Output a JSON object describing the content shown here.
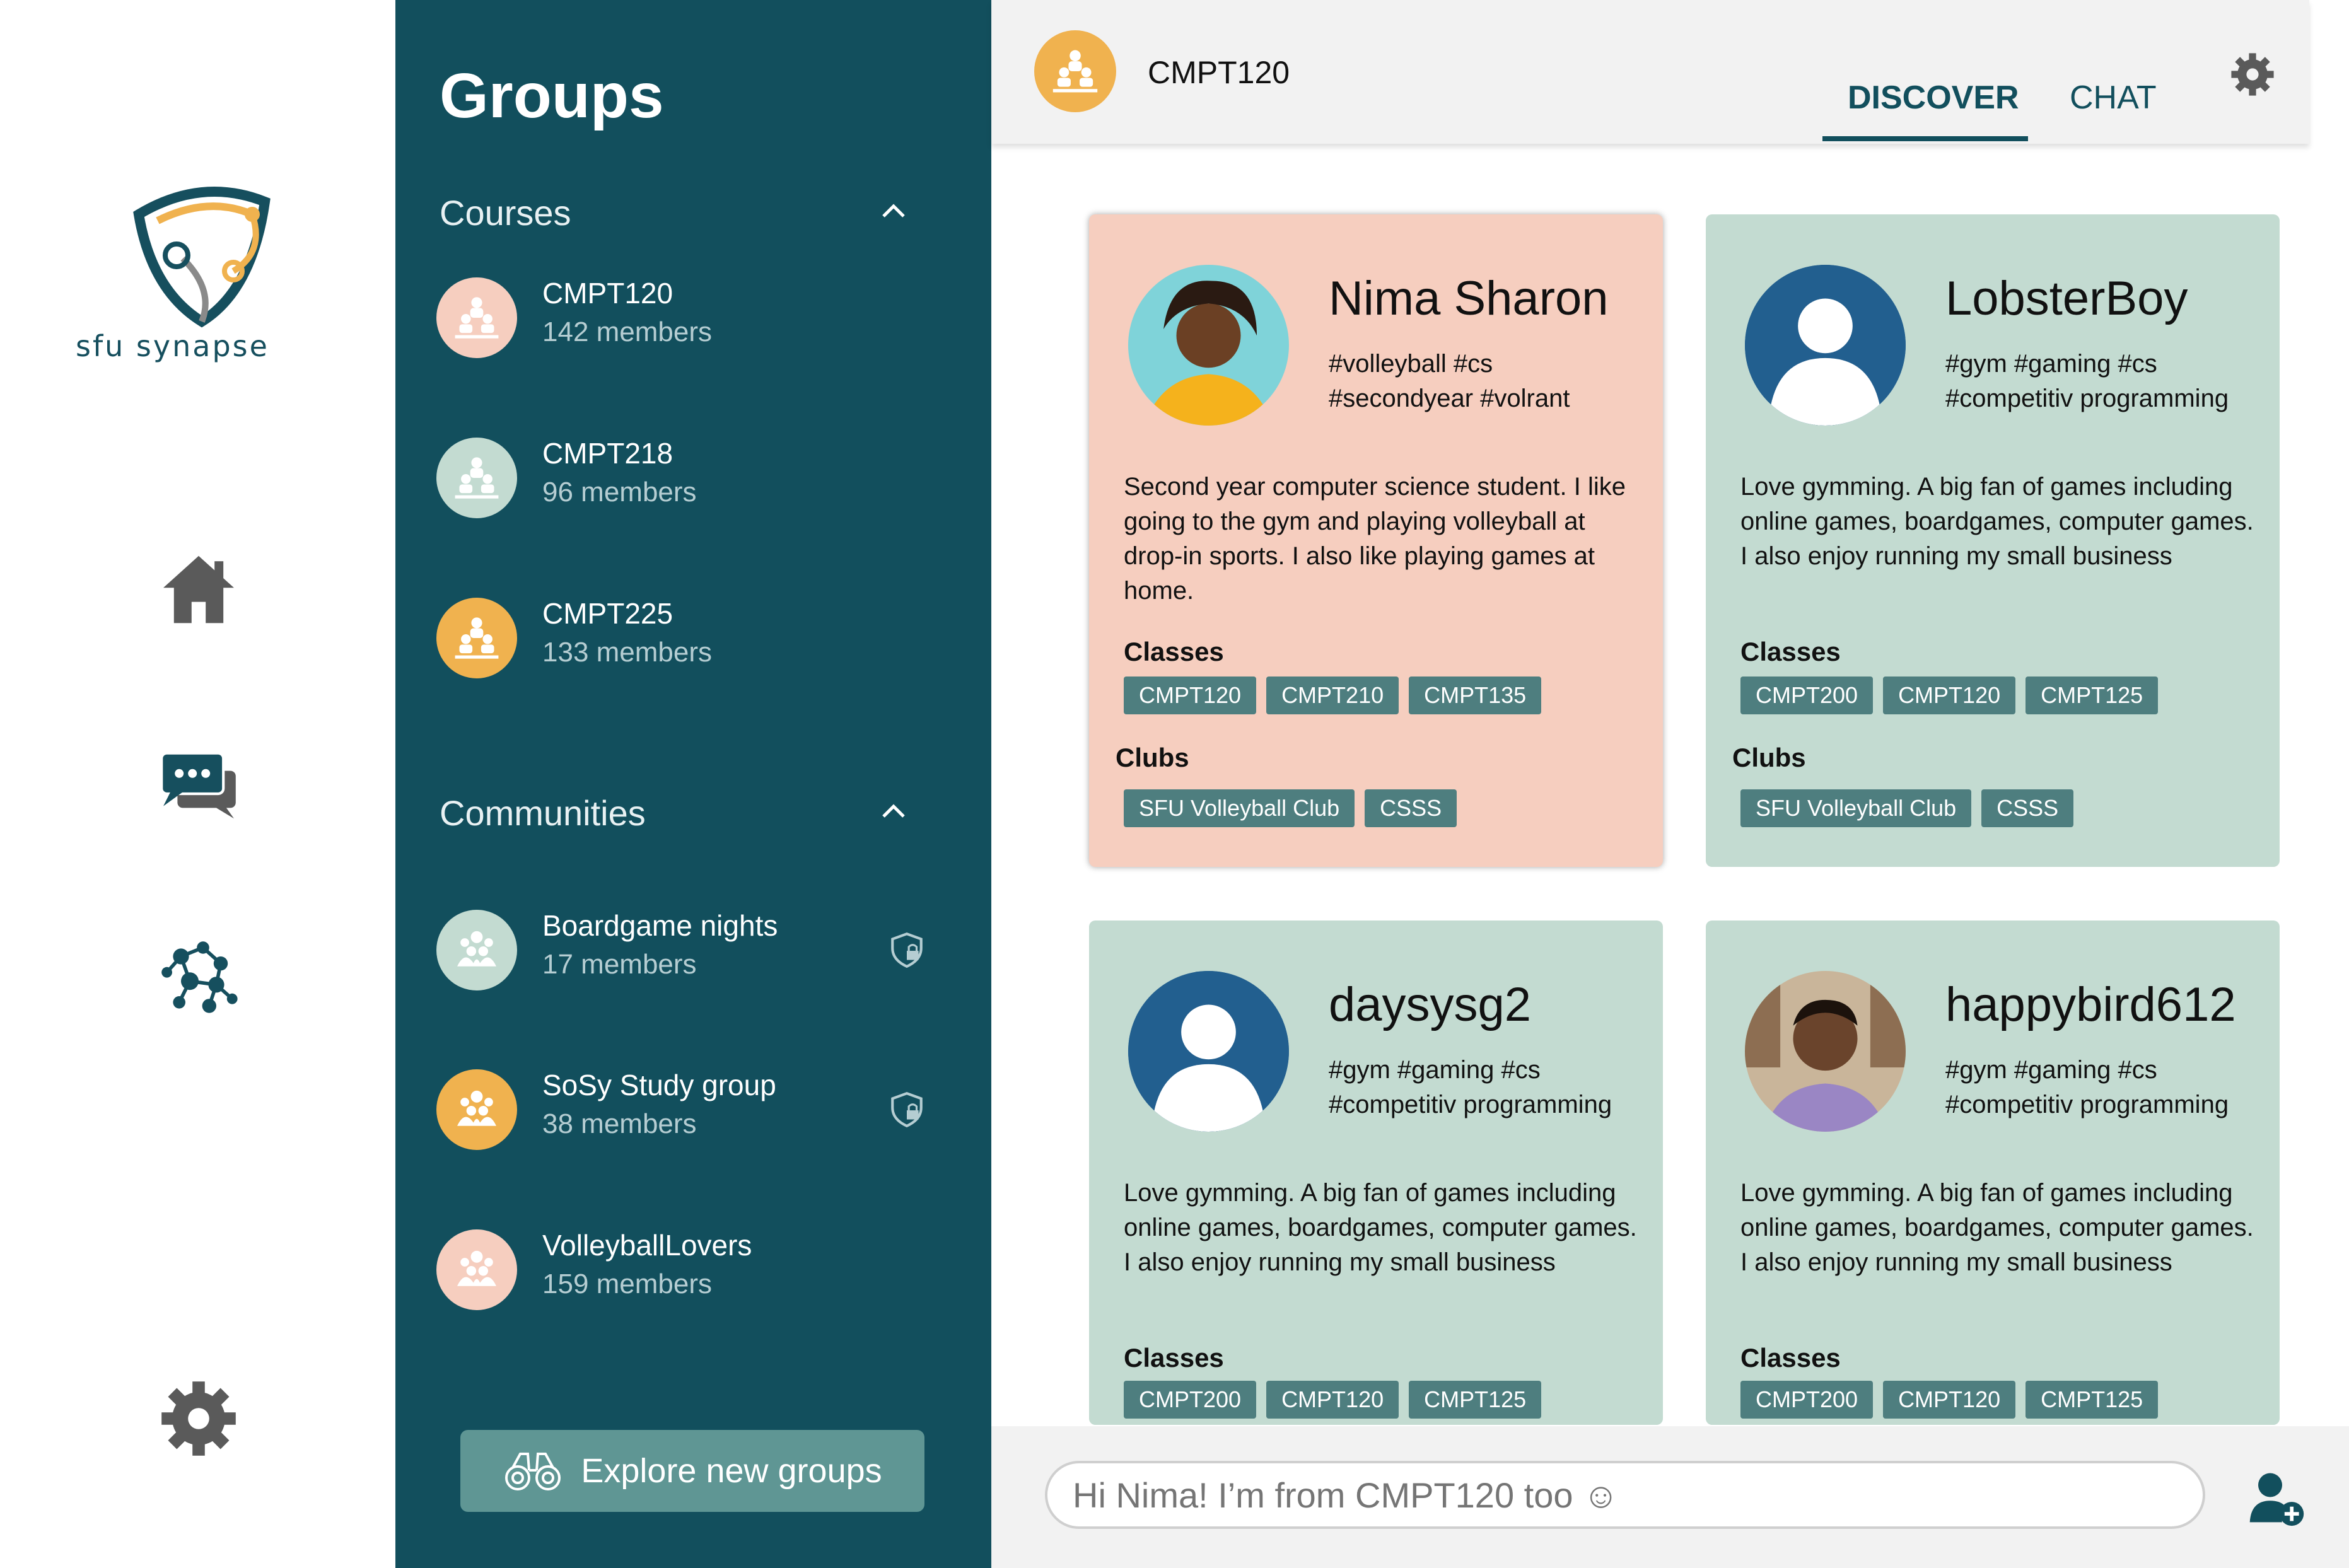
{
  "rail": {
    "logo_text": "sfu synapse",
    "icons": [
      "home-icon",
      "chat-bubbles-icon",
      "network-icon",
      "gear-icon"
    ]
  },
  "groups_panel": {
    "title": "Groups",
    "courses": {
      "heading": "Courses",
      "items": [
        {
          "name": "CMPT120",
          "count": "142 members",
          "color": "#f6cebf"
        },
        {
          "name": "CMPT218",
          "count": "96 members",
          "color": "#c3dbd1"
        },
        {
          "name": "CMPT225",
          "count": "133 members",
          "color": "#f0b24f"
        }
      ]
    },
    "communities": {
      "heading": "Communities",
      "items": [
        {
          "name": "Boardgame nights",
          "count": "17 members",
          "color": "#c3dbd1",
          "locked": true
        },
        {
          "name": "SoSy Study group",
          "count": "38 members",
          "color": "#f0b24f",
          "locked": true
        },
        {
          "name": "VolleyballLovers",
          "count": "159 members",
          "color": "#f6cebf",
          "locked": false
        }
      ]
    },
    "explore_label": "Explore new groups"
  },
  "header": {
    "title": "CMPT120",
    "tabs": [
      "DISCOVER",
      "CHAT"
    ],
    "active_tab": "DISCOVER"
  },
  "cards": [
    {
      "username": "Nima Sharon",
      "tags": "#volleyball #cs #secondyear #volrant",
      "bio": "Second year computer science student. I like going to the gym and playing volleyball at drop-in sports. I also like playing games at home.",
      "classes_label": "Classes",
      "classes": [
        "CMPT120",
        "CMPT210",
        "CMPT135"
      ],
      "clubs_label": "Clubs",
      "clubs": [
        "SFU Volleyball Club",
        "CSSS"
      ],
      "highlighted": true
    },
    {
      "username": "LobsterBoy",
      "tags": "#gym #gaming #cs #competitiv programming",
      "bio": "Love gymming. A big fan of games including online games, boardgames, computer games. I also enjoy running my small business",
      "classes_label": "Classes",
      "classes": [
        "CMPT200",
        "CMPT120",
        "CMPT125"
      ],
      "clubs_label": "Clubs",
      "clubs": [
        "SFU Volleyball Club",
        "CSSS"
      ],
      "highlighted": false
    },
    {
      "username": "daysysg2",
      "tags": "#gym #gaming #cs #competitiv programming",
      "bio": "Love gymming. A big fan of games including online games, boardgames, computer games. I also enjoy running my small business",
      "classes_label": "Classes",
      "classes": [
        "CMPT200",
        "CMPT120",
        "CMPT125"
      ],
      "highlighted": false
    },
    {
      "username": "happybird612",
      "tags": "#gym #gaming #cs #competitiv programming",
      "bio": "Love gymming. A big fan of games including online games, boardgames, computer games. I also enjoy running my small business",
      "classes_label": "Classes",
      "classes": [
        "CMPT200",
        "CMPT120",
        "CMPT125"
      ],
      "highlighted": false
    }
  ],
  "message": {
    "placeholder": "Hi Nima! I’m from CMPT120 too ☺"
  },
  "colors": {
    "panel": "#124f5d",
    "card_highlight": "#f6cebf",
    "card_plain": "#c3dbd1",
    "pill": "#4e7e7f",
    "accent_orange": "#f0b24f"
  }
}
